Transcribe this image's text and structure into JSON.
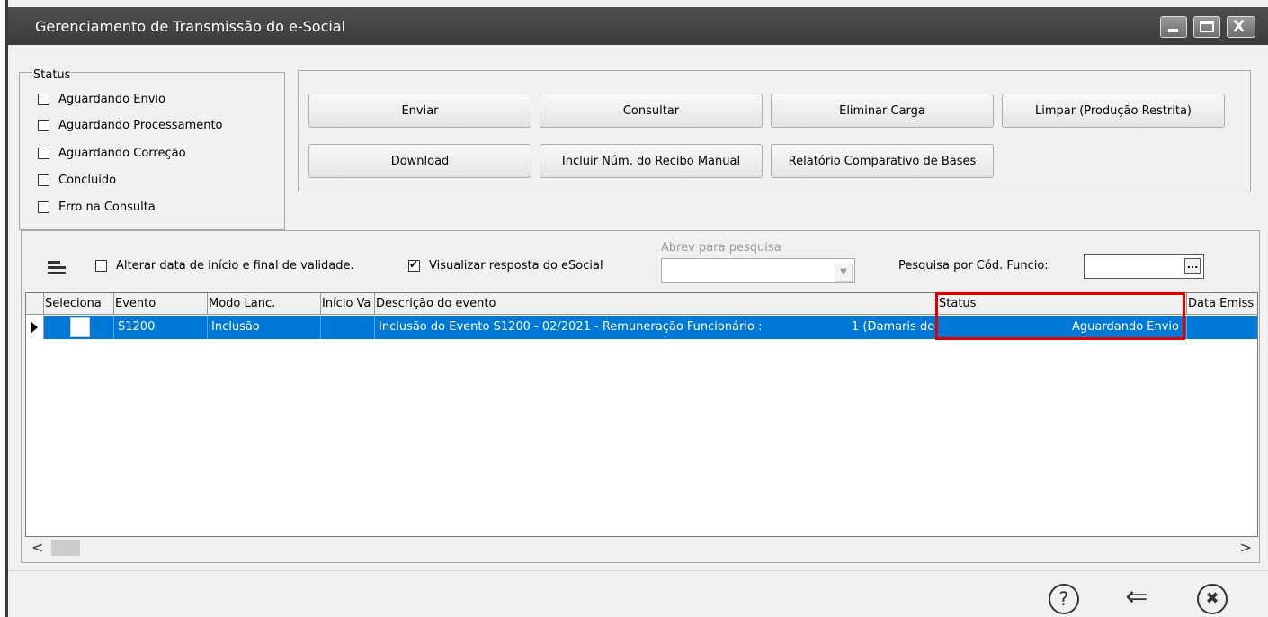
{
  "window": {
    "title": "Gerenciamento de Transmissão do e-Social",
    "min_glyph": "_",
    "max_glyph": "",
    "close_glyph": "X"
  },
  "status_group": {
    "legend": "Status",
    "options": [
      {
        "label": "Aguardando Envio",
        "checked": false
      },
      {
        "label": "Aguardando Processamento",
        "checked": false
      },
      {
        "label": "Aguardando Correção",
        "checked": false
      },
      {
        "label": "Concluído",
        "checked": false
      },
      {
        "label": "Erro na Consulta",
        "checked": false
      }
    ]
  },
  "actions": {
    "enviar": "Enviar",
    "consultar": "Consultar",
    "eliminar_carga": "Eliminar Carga",
    "limpar": "Limpar (Produção Restrita)",
    "download": "Download",
    "incluir_recibo": "Incluir Núm. do Recibo Manual",
    "relatorio": "Relatório Comparativo de Bases"
  },
  "filters": {
    "alterar_data": {
      "label": "Alterar data de início e final de validade.",
      "checked": false
    },
    "visualizar_resposta": {
      "label": "Visualizar resposta do eSocial",
      "checked": true
    },
    "abrev_label": "Abrev para pesquisa",
    "abrev_value": "",
    "pesquisa_label": "Pesquisa por Cód. Funcio:",
    "pesquisa_value": "",
    "ellipsis": "..."
  },
  "grid": {
    "columns": [
      "Seleciona",
      "Evento",
      "Modo Lanc.",
      "Início Va",
      "Descrição do evento",
      "Status",
      "Data Emiss"
    ],
    "rows": [
      {
        "selected": false,
        "evento": "S1200",
        "modo": "Inclusão",
        "inicio": "",
        "descricao": "Inclusão do Evento S1200 - 02/2021 - Remuneração Funcionário :",
        "descricao_extra": "1 (Damaris do",
        "status": "Aguardando Envio",
        "data_emissao": ""
      }
    ]
  },
  "scroll": {
    "left_glyph": "<",
    "right_glyph": ">"
  },
  "footer": {
    "help_glyph": "?",
    "back_glyph": "⇐",
    "close_glyph": "✖"
  },
  "colors": {
    "selection": "#0078d7",
    "highlight": "#e00000",
    "titlebar": "#444444"
  }
}
